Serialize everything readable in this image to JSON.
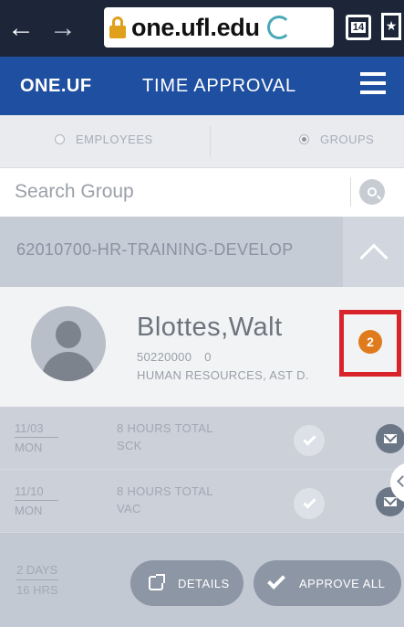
{
  "browser": {
    "back_icon": "←",
    "forward_icon": "→",
    "url": "one.ufl.edu",
    "tab_count": "14",
    "bookmark_icon": "bookmark-icon"
  },
  "header": {
    "brand": "ONE.UF",
    "page_title": "TIME APPROVAL",
    "menu_icon": "hamburger-menu-icon"
  },
  "filter": {
    "options": [
      {
        "label": "EMPLOYEES",
        "selected": false
      },
      {
        "label": "GROUPS",
        "selected": true
      }
    ]
  },
  "search": {
    "placeholder": "Search Group",
    "icon": "search-icon"
  },
  "group": {
    "name": "62010700-HR-TRAINING-DEVELOP"
  },
  "employee": {
    "name": "Blottes,Walt",
    "id": "50220000",
    "num": "0",
    "department": "HUMAN RESOURCES, AST D.",
    "pending_count": "2"
  },
  "entries": [
    {
      "date": "11/03",
      "weekday": "MON",
      "total": "8 HOURS TOTAL",
      "code": "SCK"
    },
    {
      "date": "11/10",
      "weekday": "MON",
      "total": "8 HOURS TOTAL",
      "code": "VAC"
    }
  ],
  "footer": {
    "days": "2 DAYS",
    "hours": "16 HRS",
    "details_label": "DETAILS",
    "approve_label": "APPROVE ALL"
  },
  "colors": {
    "header_blue": "#1f4fa0",
    "badge_orange": "#e07b1d",
    "highlight_red": "#d8232a"
  }
}
